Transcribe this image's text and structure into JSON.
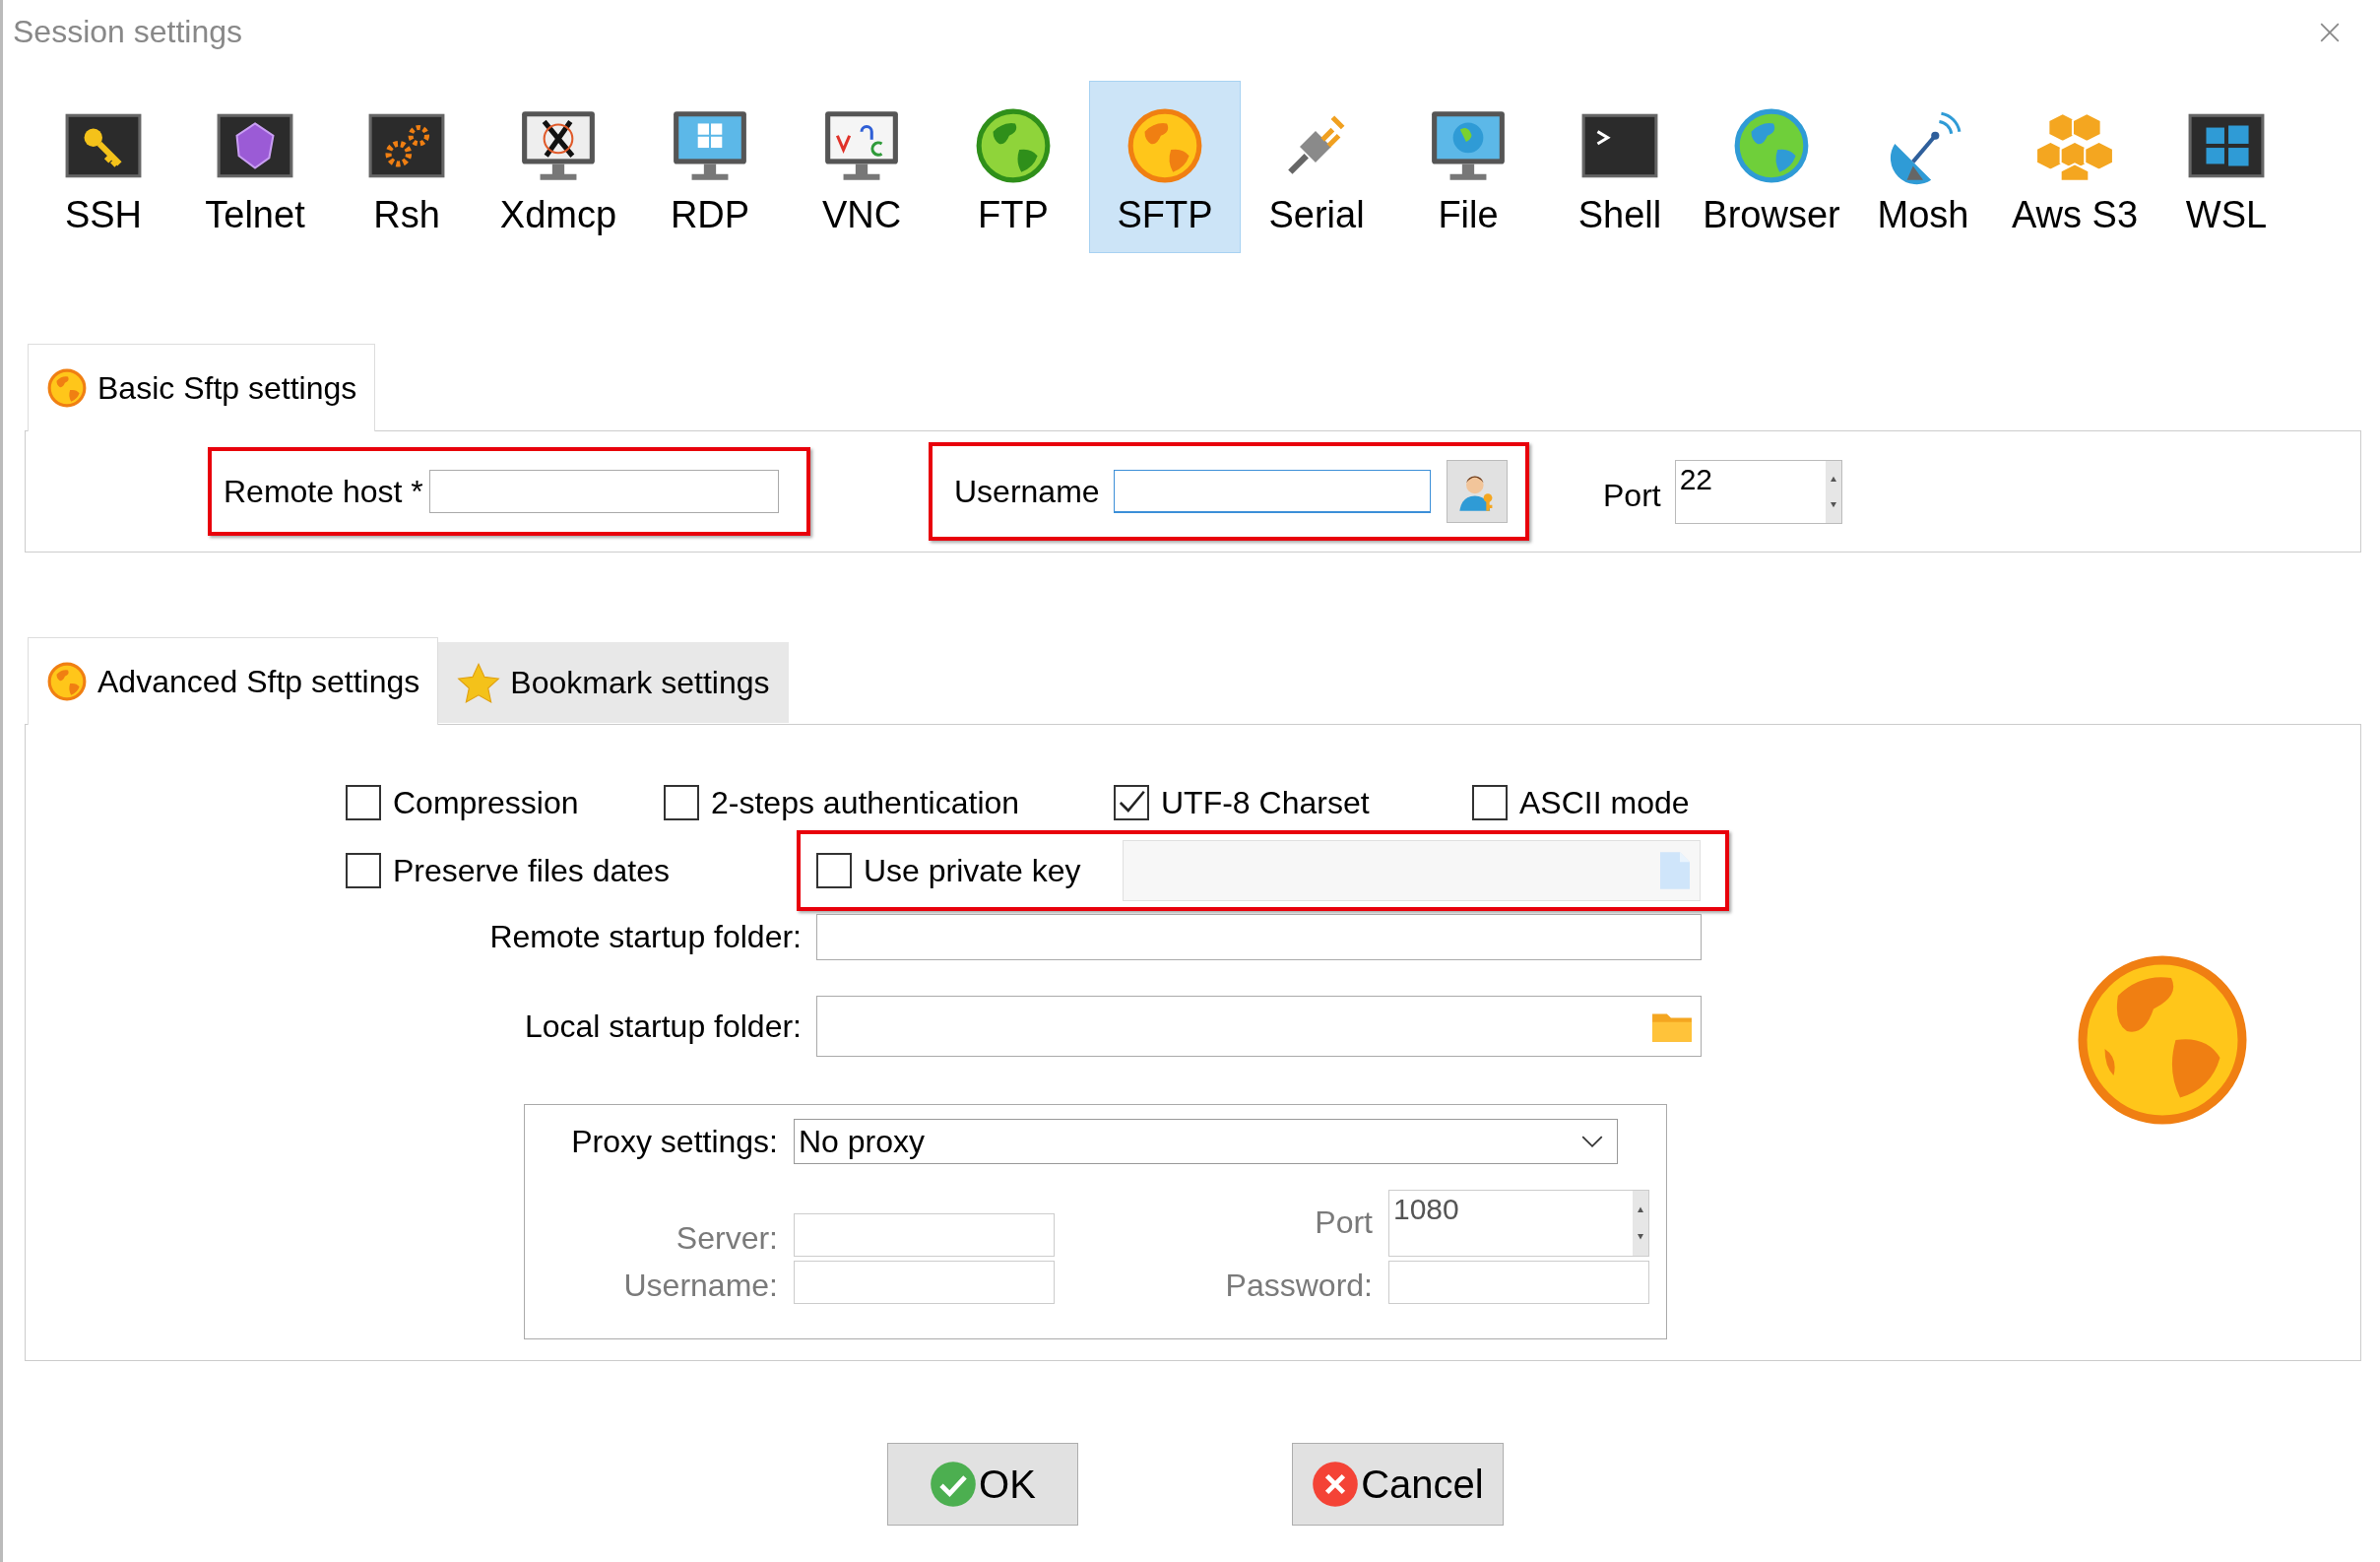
{
  "window": {
    "title": "Session settings"
  },
  "session_types": [
    {
      "label": "SSH",
      "selected": false
    },
    {
      "label": "Telnet",
      "selected": false
    },
    {
      "label": "Rsh",
      "selected": false
    },
    {
      "label": "Xdmcp",
      "selected": false
    },
    {
      "label": "RDP",
      "selected": false
    },
    {
      "label": "VNC",
      "selected": false
    },
    {
      "label": "FTP",
      "selected": false
    },
    {
      "label": "SFTP",
      "selected": true
    },
    {
      "label": "Serial",
      "selected": false
    },
    {
      "label": "File",
      "selected": false
    },
    {
      "label": "Shell",
      "selected": false
    },
    {
      "label": "Browser",
      "selected": false
    },
    {
      "label": "Mosh",
      "selected": false
    },
    {
      "label": "Aws S3",
      "selected": false
    },
    {
      "label": "WSL",
      "selected": false
    }
  ],
  "basic_tab": {
    "label": "Basic Sftp settings",
    "selected": true
  },
  "remote_host": {
    "label": "Remote host *",
    "highlighted": true
  },
  "username": {
    "label": "Username",
    "highlighted": true
  },
  "port": {
    "label": "Port",
    "value": "22"
  },
  "advanced_tabs": [
    {
      "label": "Advanced Sftp settings",
      "selected": true,
      "kind": "globe"
    },
    {
      "label": "Bookmark settings",
      "selected": false,
      "kind": "star"
    }
  ],
  "options": [
    {
      "label": "Compression",
      "checked": false
    },
    {
      "label": "2-steps authentication",
      "checked": false
    },
    {
      "label": "UTF-8 Charset",
      "checked": true
    },
    {
      "label": "ASCII mode",
      "checked": false
    },
    {
      "label": "Preserve files dates",
      "checked": false
    }
  ],
  "private_key": {
    "label": "Use private key",
    "checked": false,
    "highlighted": true
  },
  "remote_startup_folder": {
    "label": "Remote startup folder:"
  },
  "local_startup_folder": {
    "label": "Local startup folder:"
  },
  "proxy": {
    "label": "Proxy settings:",
    "value": "No proxy",
    "server_label": "Server:",
    "port_label": "Port",
    "port_value": "1080",
    "username_label": "Username:",
    "password_label": "Password:",
    "disabled": true
  },
  "buttons": [
    {
      "label": "OK",
      "kind": "ok"
    },
    {
      "label": "Cancel",
      "kind": "cancel"
    }
  ]
}
